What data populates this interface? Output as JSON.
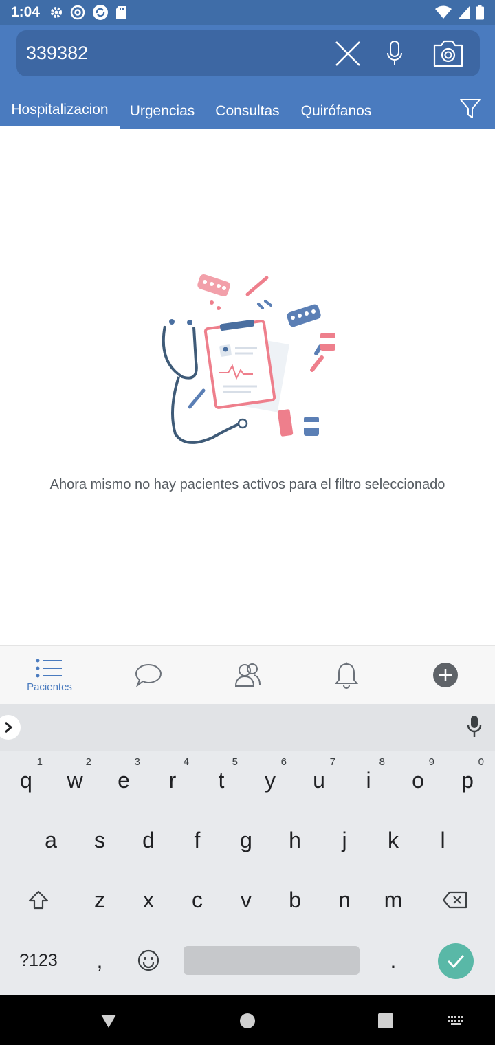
{
  "status_bar": {
    "time": "1:04",
    "left_icons": [
      "gear-icon",
      "chrome-icon",
      "sync-icon",
      "sd-card-icon"
    ],
    "right_icons": [
      "wifi-icon",
      "signal-icon",
      "battery-icon"
    ]
  },
  "search": {
    "value": "339382",
    "placeholder": ""
  },
  "tabs": [
    {
      "label": "Hospitalizacion",
      "active": true
    },
    {
      "label": "Urgencias",
      "active": false
    },
    {
      "label": "Consultas",
      "active": false
    },
    {
      "label": "Quirófanos",
      "active": false
    }
  ],
  "main": {
    "empty_message": "Ahora mismo no hay pacientes activos para el filtro seleccionado"
  },
  "bottom_nav": {
    "items": [
      {
        "label": "Pacientes",
        "icon": "list-icon",
        "active": true
      },
      {
        "label": "",
        "icon": "chat-icon",
        "active": false
      },
      {
        "label": "",
        "icon": "group-icon",
        "active": false
      },
      {
        "label": "",
        "icon": "bell-icon",
        "active": false
      },
      {
        "label": "",
        "icon": "plus-circle-icon",
        "active": false
      }
    ]
  },
  "keyboard": {
    "row1": [
      "q",
      "w",
      "e",
      "r",
      "t",
      "y",
      "u",
      "i",
      "o",
      "p"
    ],
    "row1_hints": [
      "1",
      "2",
      "3",
      "4",
      "5",
      "6",
      "7",
      "8",
      "9",
      "0"
    ],
    "row2": [
      "a",
      "s",
      "d",
      "f",
      "g",
      "h",
      "j",
      "k",
      "l"
    ],
    "row3": [
      "z",
      "x",
      "c",
      "v",
      "b",
      "n",
      "m"
    ],
    "symbols_label": "?123",
    "comma": ",",
    "period": "."
  },
  "colors": {
    "header": "#4a7bbf",
    "status_bar": "#3f6da8",
    "accent": "#59b8a7"
  }
}
